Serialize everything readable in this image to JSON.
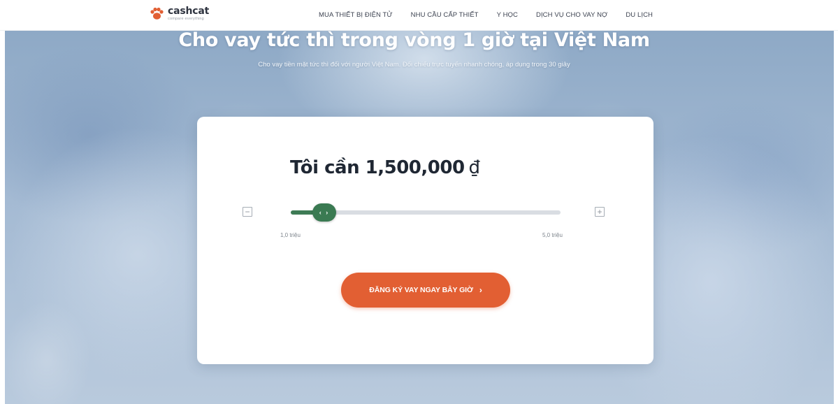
{
  "brand": {
    "name": "cashcat",
    "tagline": "compare everything",
    "accent": "#e25f33"
  },
  "nav": {
    "items": [
      "MUA THIẾT BỊ ĐIỆN TỬ",
      "NHU CẦU CẤP THIẾT",
      "Y HỌC",
      "DỊCH VỤ CHO VAY NỢ",
      "DU LỊCH"
    ]
  },
  "hero": {
    "title": "Cho vay tức thì trong vòng 1 giờ tại Việt Nam",
    "subtitle": "Cho vay tiền mặt tức thì đối với người Việt Nam. Đối chiếu trực tuyến nhanh chóng, áp dụng trong 30 giây"
  },
  "calculator": {
    "prefix": "Tôi cần",
    "amount": "1,500,000",
    "currency": "₫",
    "slider": {
      "min_label": "1,0 triệu",
      "max_label": "5,0 triệu",
      "fraction": 0.125,
      "fill_color": "#3e7b55",
      "thumb_icon": "‹ ›"
    },
    "minus_symbol": "−",
    "plus_symbol": "+",
    "cta_label": "ĐĂNG KÝ VAY NGAY BÂY GIỜ",
    "cta_icon": "›"
  }
}
